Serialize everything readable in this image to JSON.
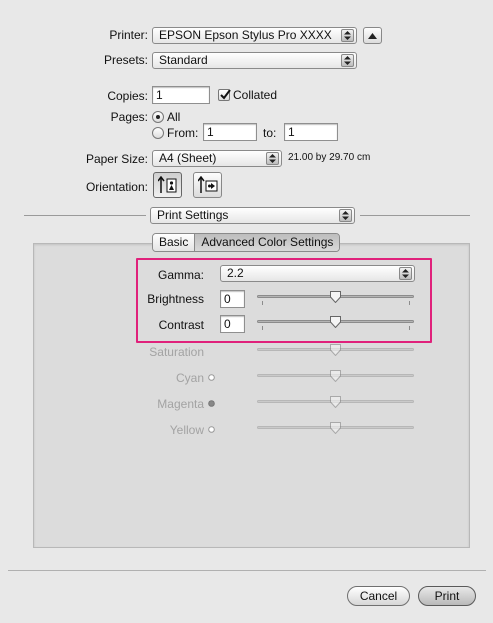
{
  "printer": {
    "label": "Printer:",
    "value": "EPSON Epson Stylus Pro XXXX"
  },
  "presets": {
    "label": "Presets:",
    "value": "Standard"
  },
  "copies": {
    "label": "Copies:",
    "value": "1",
    "collated_label": "Collated",
    "collated_checked": true
  },
  "pages": {
    "label": "Pages:",
    "all_label": "All",
    "from_label": "From:",
    "from_value": "1",
    "to_label": "to:",
    "to_value": "1"
  },
  "paper_size": {
    "label": "Paper Size:",
    "value": "A4 (Sheet)",
    "dimensions": "21.00 by 29.70 cm"
  },
  "orientation": {
    "label": "Orientation:"
  },
  "section": {
    "value": "Print Settings"
  },
  "tabs": [
    {
      "label": "Basic",
      "active": false
    },
    {
      "label": "Advanced Color Settings",
      "active": true
    }
  ],
  "gamma": {
    "label": "Gamma:",
    "value": "2.2"
  },
  "sliders": [
    {
      "label": "Brightness",
      "value": "0",
      "enabled": true,
      "level": 0.5
    },
    {
      "label": "Contrast",
      "value": "0",
      "enabled": true,
      "level": 0.5
    },
    {
      "label": "Saturation",
      "enabled": false,
      "level": 0.5
    },
    {
      "label": "Cyan",
      "enabled": false,
      "level": 0.5,
      "dot": "open"
    },
    {
      "label": "Magenta",
      "enabled": false,
      "level": 0.5,
      "dot": "filled"
    },
    {
      "label": "Yellow",
      "enabled": false,
      "level": 0.5,
      "dot": "open"
    }
  ],
  "buttons": {
    "cancel": "Cancel",
    "print": "Print"
  },
  "colors": {
    "highlight": "#e0217b"
  },
  "icons": {
    "printer_expand": "triangle-up-icon",
    "portrait": "portrait-orientation-icon",
    "landscape": "landscape-orientation-icon",
    "popup": "updown-arrows-icon"
  }
}
